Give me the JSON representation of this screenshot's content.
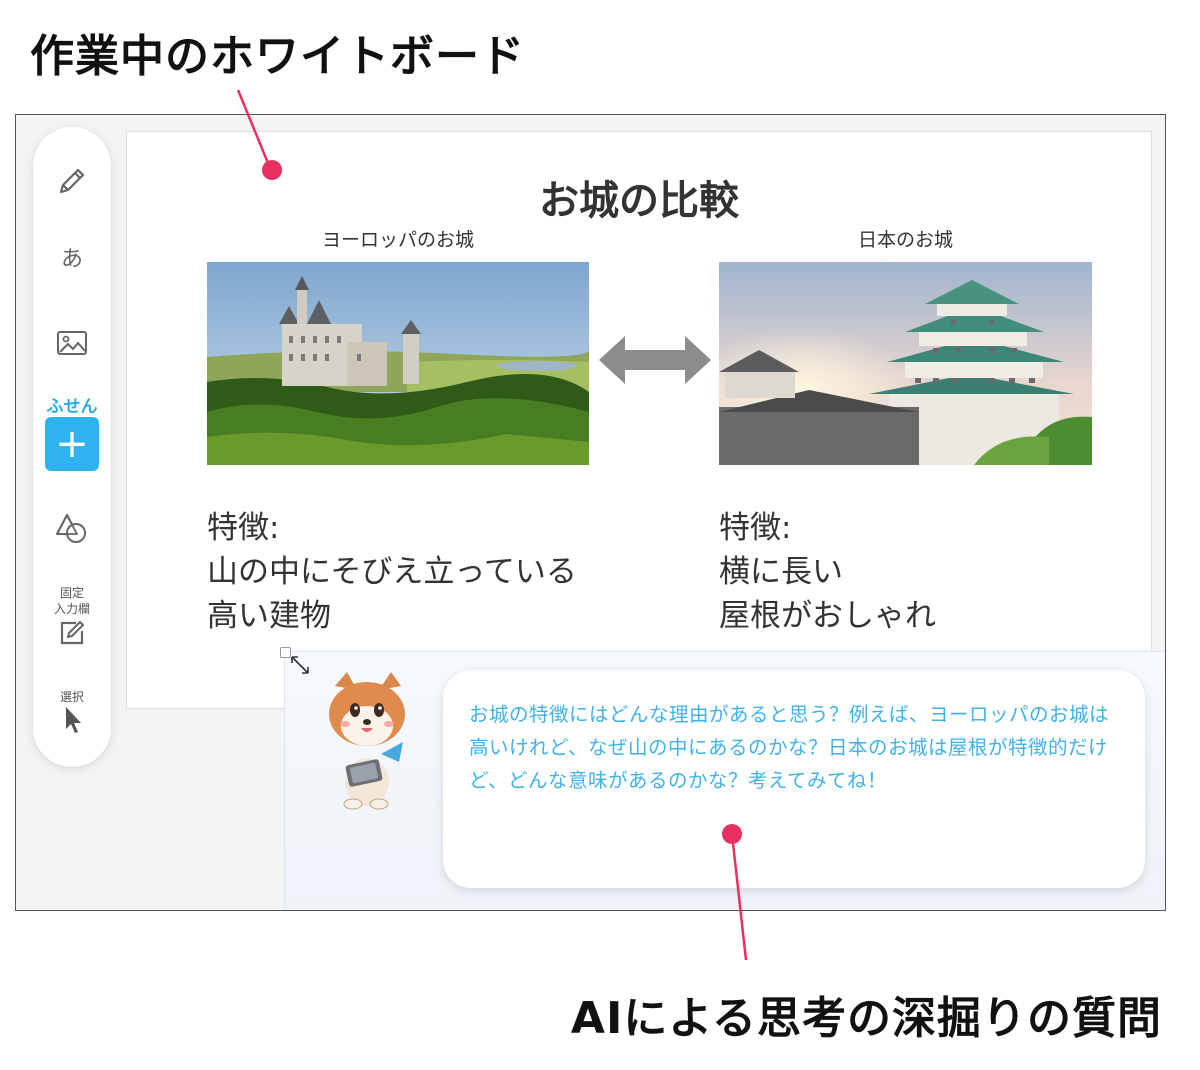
{
  "annotations": {
    "top_caption": "作業中のホワイトボード",
    "bottom_caption": "AIによる思考の深掘りの質問",
    "accent_color": "#e8305e"
  },
  "toolbar": {
    "items": [
      {
        "icon": "pencil-icon"
      },
      {
        "label": "あ",
        "icon": "text-icon"
      },
      {
        "icon": "image-icon"
      },
      {
        "label": "ふせん",
        "icon": "plus-icon"
      },
      {
        "icon": "shapes-icon"
      },
      {
        "label": "固定\n入力欄",
        "icon": "edit-box-icon"
      },
      {
        "label": "選択",
        "icon": "cursor-icon"
      }
    ],
    "fusen_color": "#2eb3f0"
  },
  "board": {
    "title": "お城の比較",
    "left": {
      "label": "ヨーロッパのお城",
      "features": [
        "特徴:",
        "山の中にそびえ立っている",
        "高い建物"
      ]
    },
    "right": {
      "label": "日本のお城",
      "features": [
        "特徴:",
        "横に長い",
        "屋根がおしゃれ"
      ]
    },
    "arrow_icon": "double-arrow-icon"
  },
  "ai_panel": {
    "message": "お城の特徴にはどんな理由があると思う？例えば、ヨーロッパのお城は高いけれど、なぜ山の中にあるのかな？日本のお城は屋根が特徴的だけど、どんな意味があるのかな？考えてみてね！",
    "close_icon": "close-icon",
    "text_color": "#3fb2ea"
  }
}
